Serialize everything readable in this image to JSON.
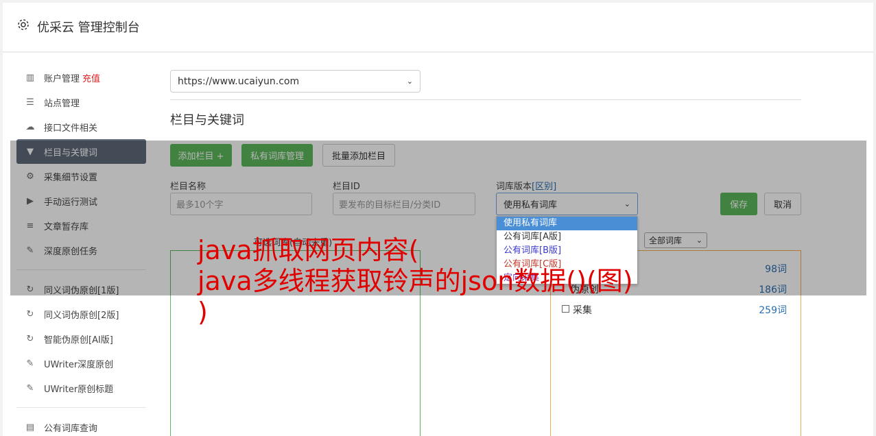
{
  "app": {
    "title": "优采云 管理控制台"
  },
  "sidebar": {
    "items": [
      {
        "label": "账户管理",
        "extra": "充值"
      },
      {
        "label": "站点管理"
      },
      {
        "label": "接口文件相关"
      },
      {
        "label": "栏目与关键词"
      },
      {
        "label": "采集细节设置"
      },
      {
        "label": "手动运行测试"
      },
      {
        "label": "文章暂存库"
      },
      {
        "label": "深度原创任务"
      },
      {
        "label": "同义词伪原创[1版]"
      },
      {
        "label": "同义词伪原创[2版]"
      },
      {
        "label": "智能伪原创[AI版]"
      },
      {
        "label": "UWriter深度原创"
      },
      {
        "label": "UWriter原创标题"
      },
      {
        "label": "公有词库查询"
      }
    ]
  },
  "main": {
    "site_select": "https://www.ucaiyun.com",
    "section_title": "栏目与关键词",
    "buttons": {
      "add_column": "添加栏目 +",
      "private_lib": "私有词库管理",
      "batch_add": "批量添加栏目",
      "save": "保存",
      "cancel": "取消"
    },
    "form": {
      "name_label": "栏目名称",
      "name_placeholder": "最多10个字",
      "id_label": "栏目ID",
      "id_placeholder": "要发布的目标栏目/分类ID",
      "version_label": "词库版本",
      "version_label_link": "[区别]",
      "version_value": "使用私有词库"
    },
    "version_options": [
      "使用私有词库",
      "公有词库[A版]",
      "公有词库[B版]",
      "公有词库[C版]",
      "定向采集"
    ],
    "option_colors": [
      "#ffffff",
      "#333333",
      "#3a3acc",
      "#c0392b",
      "#7a3ab8"
    ],
    "left_box_title": "可选词库(自动去重)",
    "filter_select": "全部词库",
    "libraries": [
      {
        "name": "",
        "count": "98词"
      },
      {
        "name": "伪原创",
        "count": "186词"
      },
      {
        "name": "采集",
        "count": "259词"
      }
    ]
  },
  "watermark": {
    "lines": [
      "java抓取网页内容(",
      "java多线程获取铃声的json数据()(图)",
      ")"
    ]
  }
}
